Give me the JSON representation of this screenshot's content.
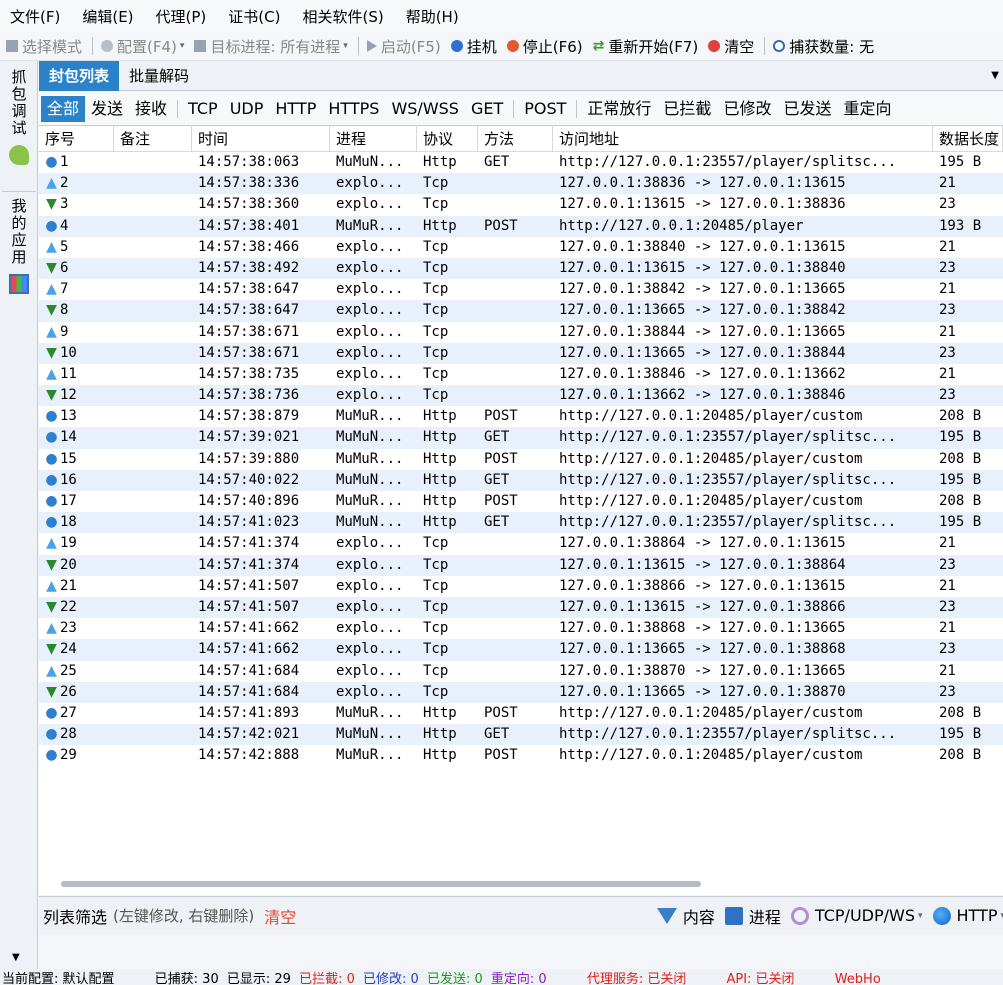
{
  "menu": [
    "文件(F)",
    "编辑(E)",
    "代理(P)",
    "证书(C)",
    "相关软件(S)",
    "帮助(H)"
  ],
  "toolbar": {
    "select_mode": "选择模式",
    "config": "配置(F4)",
    "target_process_label": "目标进程:",
    "target_process_value": "所有进程",
    "start": "启动(F5)",
    "hang": "挂机",
    "stop": "停止(F6)",
    "restart": "重新开始(F7)",
    "clear": "清空",
    "capture_count": "捕获数量: 无"
  },
  "side_tabs": {
    "capture_debug": "抓包调试",
    "my_apps": "我的应用"
  },
  "panel_tabs": [
    "封包列表",
    "批量解码"
  ],
  "filter_tabs": [
    "全部",
    "发送",
    "接收",
    "TCP",
    "UDP",
    "HTTP",
    "HTTPS",
    "WS/WSS",
    "GET",
    "POST",
    "正常放行",
    "已拦截",
    "已修改",
    "已发送",
    "重定向"
  ],
  "columns": [
    "序号",
    "备注",
    "时间",
    "进程",
    "协议",
    "方法",
    "访问地址",
    "数据长度"
  ],
  "rows": [
    {
      "icon": "globe",
      "no": "1",
      "time": "14:57:38:063",
      "proc": "MuMuN...",
      "proto": "Http",
      "method": "GET",
      "url": "http://127.0.0.1:23557/player/splitsc...",
      "len": "195 B"
    },
    {
      "icon": "up",
      "no": "2",
      "time": "14:57:38:336",
      "proc": "explo...",
      "proto": "Tcp",
      "method": "",
      "url": "127.0.0.1:38836 -> 127.0.0.1:13615",
      "len": "21"
    },
    {
      "icon": "down",
      "no": "3",
      "time": "14:57:38:360",
      "proc": "explo...",
      "proto": "Tcp",
      "method": "",
      "url": "127.0.0.1:13615 -> 127.0.0.1:38836",
      "len": "23"
    },
    {
      "icon": "globe",
      "no": "4",
      "time": "14:57:38:401",
      "proc": "MuMuR...",
      "proto": "Http",
      "method": "POST",
      "url": "http://127.0.0.1:20485/player",
      "len": "193 B"
    },
    {
      "icon": "up",
      "no": "5",
      "time": "14:57:38:466",
      "proc": "explo...",
      "proto": "Tcp",
      "method": "",
      "url": "127.0.0.1:38840 -> 127.0.0.1:13615",
      "len": "21"
    },
    {
      "icon": "down",
      "no": "6",
      "time": "14:57:38:492",
      "proc": "explo...",
      "proto": "Tcp",
      "method": "",
      "url": "127.0.0.1:13615 -> 127.0.0.1:38840",
      "len": "23"
    },
    {
      "icon": "up",
      "no": "7",
      "time": "14:57:38:647",
      "proc": "explo...",
      "proto": "Tcp",
      "method": "",
      "url": "127.0.0.1:38842 -> 127.0.0.1:13665",
      "len": "21"
    },
    {
      "icon": "down",
      "no": "8",
      "time": "14:57:38:647",
      "proc": "explo...",
      "proto": "Tcp",
      "method": "",
      "url": "127.0.0.1:13665 -> 127.0.0.1:38842",
      "len": "23"
    },
    {
      "icon": "up",
      "no": "9",
      "time": "14:57:38:671",
      "proc": "explo...",
      "proto": "Tcp",
      "method": "",
      "url": "127.0.0.1:38844 -> 127.0.0.1:13665",
      "len": "21"
    },
    {
      "icon": "down",
      "no": "10",
      "time": "14:57:38:671",
      "proc": "explo...",
      "proto": "Tcp",
      "method": "",
      "url": "127.0.0.1:13665 -> 127.0.0.1:38844",
      "len": "23"
    },
    {
      "icon": "up",
      "no": "11",
      "time": "14:57:38:735",
      "proc": "explo...",
      "proto": "Tcp",
      "method": "",
      "url": "127.0.0.1:38846 -> 127.0.0.1:13662",
      "len": "21"
    },
    {
      "icon": "down",
      "no": "12",
      "time": "14:57:38:736",
      "proc": "explo...",
      "proto": "Tcp",
      "method": "",
      "url": "127.0.0.1:13662 -> 127.0.0.1:38846",
      "len": "23"
    },
    {
      "icon": "globe",
      "no": "13",
      "time": "14:57:38:879",
      "proc": "MuMuR...",
      "proto": "Http",
      "method": "POST",
      "url": "http://127.0.0.1:20485/player/custom",
      "len": "208 B"
    },
    {
      "icon": "globe",
      "no": "14",
      "time": "14:57:39:021",
      "proc": "MuMuN...",
      "proto": "Http",
      "method": "GET",
      "url": "http://127.0.0.1:23557/player/splitsc...",
      "len": "195 B"
    },
    {
      "icon": "globe",
      "no": "15",
      "time": "14:57:39:880",
      "proc": "MuMuR...",
      "proto": "Http",
      "method": "POST",
      "url": "http://127.0.0.1:20485/player/custom",
      "len": "208 B"
    },
    {
      "icon": "globe",
      "no": "16",
      "time": "14:57:40:022",
      "proc": "MuMuN...",
      "proto": "Http",
      "method": "GET",
      "url": "http://127.0.0.1:23557/player/splitsc...",
      "len": "195 B"
    },
    {
      "icon": "globe",
      "no": "17",
      "time": "14:57:40:896",
      "proc": "MuMuR...",
      "proto": "Http",
      "method": "POST",
      "url": "http://127.0.0.1:20485/player/custom",
      "len": "208 B"
    },
    {
      "icon": "globe",
      "no": "18",
      "time": "14:57:41:023",
      "proc": "MuMuN...",
      "proto": "Http",
      "method": "GET",
      "url": "http://127.0.0.1:23557/player/splitsc...",
      "len": "195 B"
    },
    {
      "icon": "up",
      "no": "19",
      "time": "14:57:41:374",
      "proc": "explo...",
      "proto": "Tcp",
      "method": "",
      "url": "127.0.0.1:38864 -> 127.0.0.1:13615",
      "len": "21"
    },
    {
      "icon": "down",
      "no": "20",
      "time": "14:57:41:374",
      "proc": "explo...",
      "proto": "Tcp",
      "method": "",
      "url": "127.0.0.1:13615 -> 127.0.0.1:38864",
      "len": "23"
    },
    {
      "icon": "up",
      "no": "21",
      "time": "14:57:41:507",
      "proc": "explo...",
      "proto": "Tcp",
      "method": "",
      "url": "127.0.0.1:38866 -> 127.0.0.1:13615",
      "len": "21"
    },
    {
      "icon": "down",
      "no": "22",
      "time": "14:57:41:507",
      "proc": "explo...",
      "proto": "Tcp",
      "method": "",
      "url": "127.0.0.1:13615 -> 127.0.0.1:38866",
      "len": "23"
    },
    {
      "icon": "up",
      "no": "23",
      "time": "14:57:41:662",
      "proc": "explo...",
      "proto": "Tcp",
      "method": "",
      "url": "127.0.0.1:38868 -> 127.0.0.1:13665",
      "len": "21"
    },
    {
      "icon": "down",
      "no": "24",
      "time": "14:57:41:662",
      "proc": "explo...",
      "proto": "Tcp",
      "method": "",
      "url": "127.0.0.1:13665 -> 127.0.0.1:38868",
      "len": "23"
    },
    {
      "icon": "up",
      "no": "25",
      "time": "14:57:41:684",
      "proc": "explo...",
      "proto": "Tcp",
      "method": "",
      "url": "127.0.0.1:38870 -> 127.0.0.1:13665",
      "len": "21"
    },
    {
      "icon": "down",
      "no": "26",
      "time": "14:57:41:684",
      "proc": "explo...",
      "proto": "Tcp",
      "method": "",
      "url": "127.0.0.1:13665 -> 127.0.0.1:38870",
      "len": "23"
    },
    {
      "icon": "globe",
      "no": "27",
      "time": "14:57:41:893",
      "proc": "MuMuR...",
      "proto": "Http",
      "method": "POST",
      "url": "http://127.0.0.1:20485/player/custom",
      "len": "208 B"
    },
    {
      "icon": "globe",
      "no": "28",
      "time": "14:57:42:021",
      "proc": "MuMuN...",
      "proto": "Http",
      "method": "GET",
      "url": "http://127.0.0.1:23557/player/splitsc...",
      "len": "195 B"
    },
    {
      "icon": "globe",
      "no": "29",
      "time": "14:57:42:888",
      "proc": "MuMuR...",
      "proto": "Http",
      "method": "POST",
      "url": "http://127.0.0.1:20485/player/custom",
      "len": "208 B"
    }
  ],
  "filterbar": {
    "label": "列表筛选",
    "hint": "(左键修改, 右键删除)",
    "clear": "清空",
    "content": "内容",
    "process": "进程",
    "tcp_udp_ws": "TCP/UDP/WS",
    "http": "HTTP"
  },
  "status": {
    "current_config": "当前配置: 默认配置",
    "captured": "已捕获: 30",
    "shown": "已显示: 29",
    "intercepted": "已拦截: 0",
    "modified": "已修改: 0",
    "sent": "已发送: 0",
    "redirected": "重定向: 0",
    "proxy_service": "代理服务: 已关闭",
    "api": "API: 已关闭",
    "webhook": "WebHo"
  },
  "colors": {
    "accent": "#2b82c9",
    "row_alt": "#e8f1fb",
    "clear_red": "#e2462e"
  }
}
